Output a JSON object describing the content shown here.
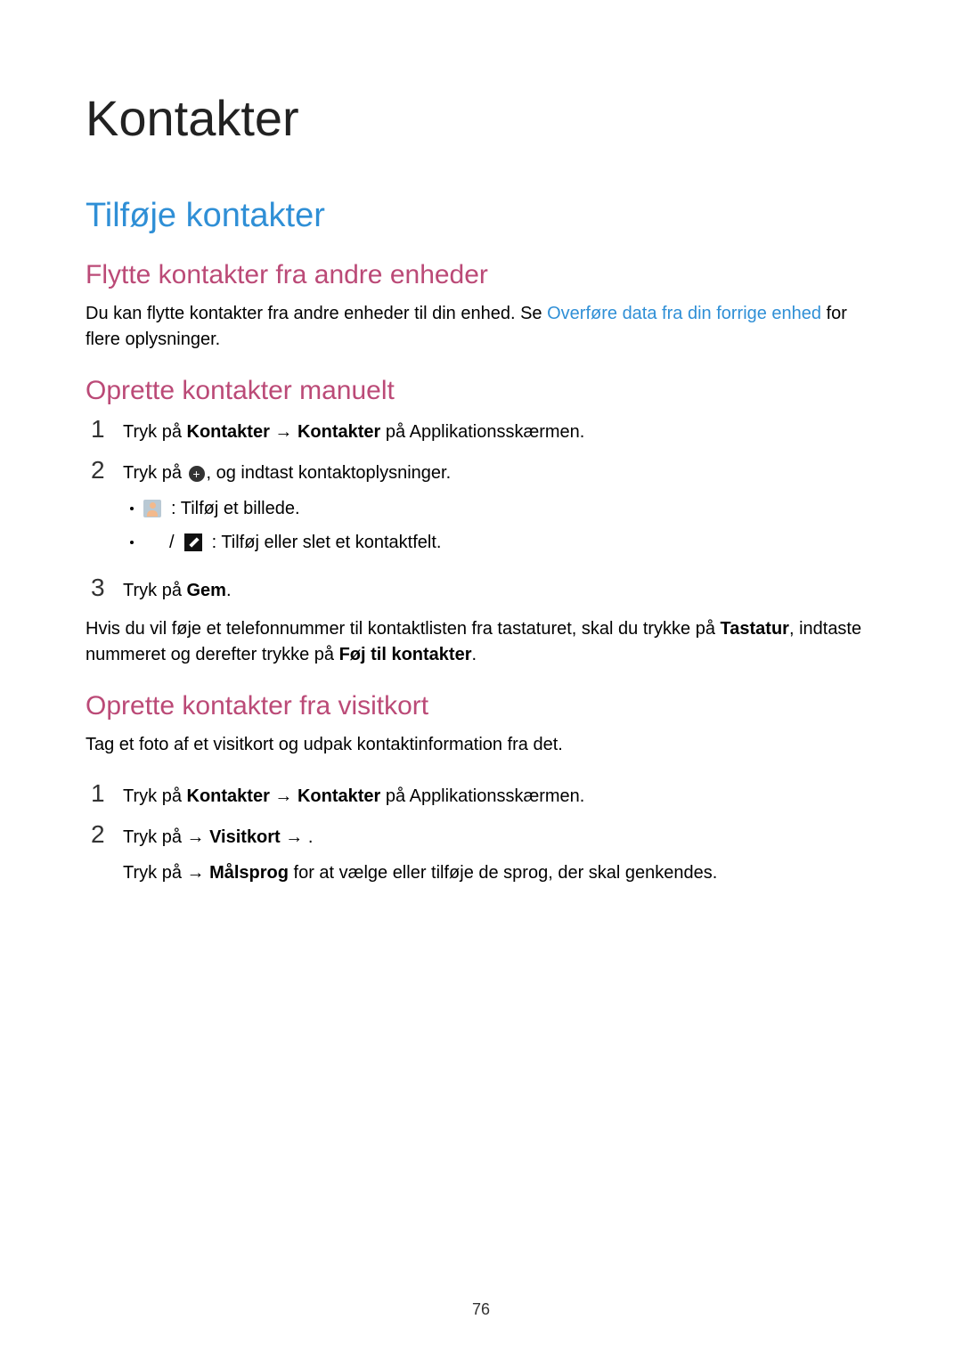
{
  "page_number": "76",
  "h1": "Kontakter",
  "h2": "Tilføje kontakter",
  "sections": {
    "move": {
      "heading": "Flytte kontakter fra andre enheder",
      "para_pre": "Du kan flytte kontakter fra andre enheder til din enhed. Se ",
      "para_link": "Overføre data fra din forrige enhed",
      "para_post": " for flere oplysninger."
    },
    "manual": {
      "heading": "Oprette kontakter manuelt",
      "step1_pre": "Tryk på ",
      "step1_b1": "Kontakter",
      "step1_arrow": " → ",
      "step1_b2": "Kontakter",
      "step1_post": " på Applikationsskærmen.",
      "step2_pre": "Tryk på ",
      "step2_post": ", og indtast kontaktoplysninger.",
      "bullet1": " : Tilføj et billede.",
      "bullet2_sep": " / ",
      "bullet2_text": " : Tilføj eller slet et kontaktfelt.",
      "step3_pre": "Tryk på ",
      "step3_b": "Gem",
      "step3_post": ".",
      "tail_pre": "Hvis du vil føje et telefonnummer til kontaktlisten fra tastaturet, skal du trykke på ",
      "tail_b1": "Tastatur",
      "tail_mid": ", indtaste nummeret og derefter trykke på ",
      "tail_b2": "Føj til kontakter",
      "tail_post": "."
    },
    "bizcard": {
      "heading": "Oprette kontakter fra visitkort",
      "intro": "Tag et foto af et visitkort og udpak kontaktinformation fra det.",
      "step1_pre": "Tryk på ",
      "step1_b1": "Kontakter",
      "step1_arrow": " → ",
      "step1_b2": "Kontakter",
      "step1_post": " på Applikationsskærmen.",
      "step2_pre": "Tryk på ",
      "step2_arrow1": " → ",
      "step2_b": "Visitkort",
      "step2_arrow2": " → ",
      "step2_post": ".",
      "step2b_pre": "Tryk på ",
      "step2b_arrow": " → ",
      "step2b_b": "Målsprog",
      "step2b_post": " for at vælge eller tilføje de sprog, der skal genkendes."
    }
  }
}
